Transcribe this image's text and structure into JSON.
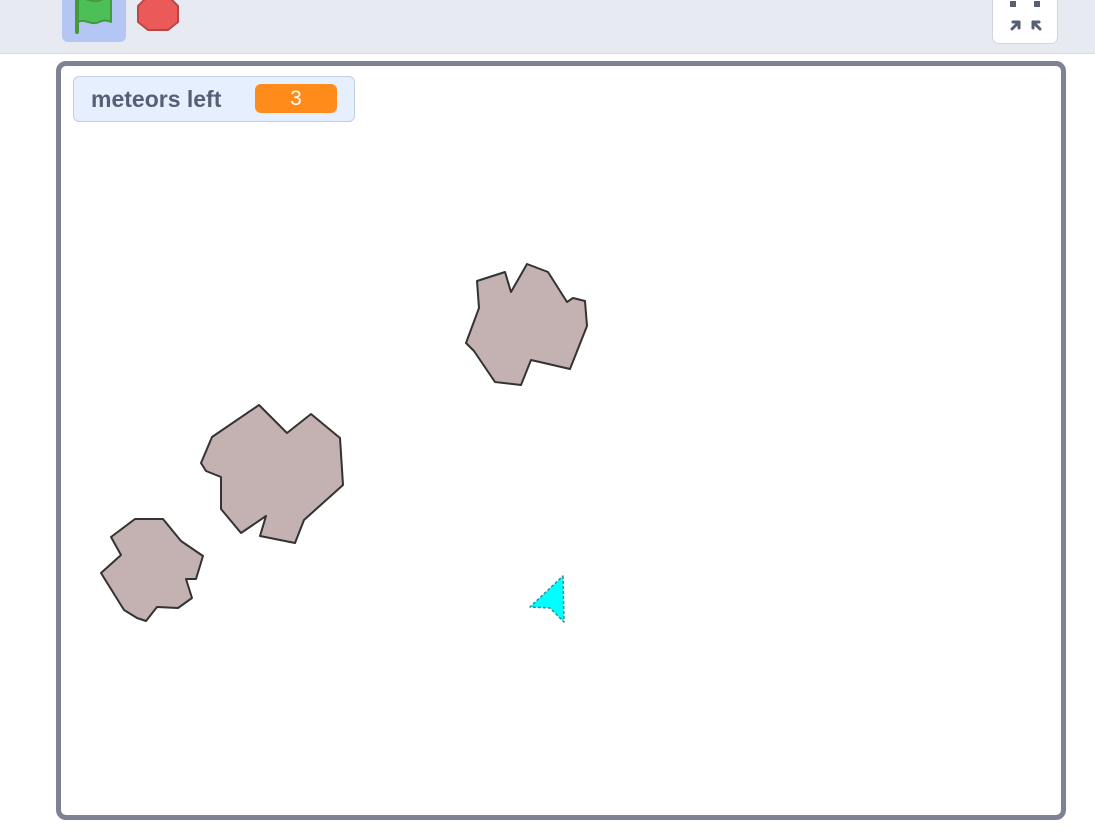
{
  "toolbar": {
    "green_flag_icon": "green-flag-icon",
    "stop_icon": "stop-sign-icon",
    "fullscreen_icon": "exit-fullscreen-icon"
  },
  "stage": {
    "monitor": {
      "label": "meteors left",
      "value": "3"
    },
    "sprites": {
      "meteor_color": "#c4b1b1",
      "ship_color": "#00ffff"
    }
  },
  "colors": {
    "toolbar_bg": "#e7ebf1",
    "flag_button_bg": "#b3c6f4",
    "stage_border": "#7f8295",
    "monitor_bg": "#e5effe",
    "monitor_value_bg": "#ff8c1a",
    "monitor_label": "#575e75"
  }
}
